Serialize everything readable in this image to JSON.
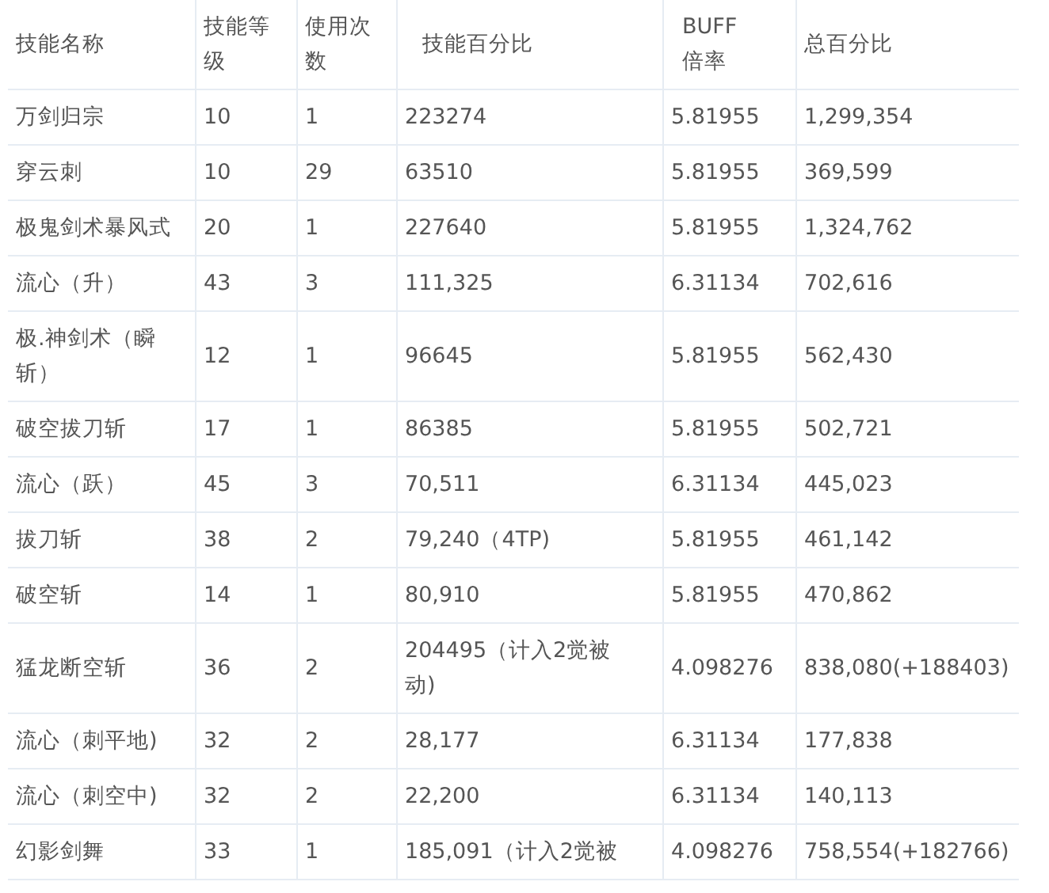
{
  "table": {
    "columns": [
      "技能名称",
      "技能等级",
      "使用次数",
      "技能百分比",
      "BUFF倍率",
      "总百分比"
    ],
    "rows": [
      {
        "cells": [
          "万剑归宗",
          "10",
          "1",
          "223274",
          "5.81955",
          "1,299,354"
        ]
      },
      {
        "cells": [
          "穿云刺",
          "10",
          "29",
          "63510",
          "5.81955",
          "369,599"
        ]
      },
      {
        "cells": [
          "极鬼剑术暴风式",
          "20",
          "1",
          "227640",
          "5.81955",
          "1,324,762"
        ]
      },
      {
        "cells": [
          "流心（升）",
          "43",
          "3",
          "111,325",
          "6.31134",
          "702,616"
        ]
      },
      {
        "cells": [
          "极.神剑术（瞬斩）",
          "12",
          "1",
          "96645",
          "5.81955",
          "562,430"
        ]
      },
      {
        "cells": [
          "破空拔刀斩",
          "17",
          "1",
          "86385",
          "5.81955",
          "502,721"
        ]
      },
      {
        "cells": [
          "流心（跃）",
          "45",
          "3",
          "70,511",
          "6.31134",
          "445,023"
        ]
      },
      {
        "cells": [
          "拔刀斩",
          "38",
          "2",
          "79,240（4TP)",
          "5.81955",
          "461,142"
        ]
      },
      {
        "cells": [
          "破空斩",
          "14",
          "1",
          "80,910",
          "5.81955",
          "470,862"
        ]
      },
      {
        "cells": [
          "猛龙断空斩",
          "36",
          "2",
          "204495（计入2觉被动)",
          "4.098276",
          "838,080(+188403)"
        ]
      },
      {
        "cells": [
          "流心（刺平地)",
          "32",
          "2",
          "28,177",
          "6.31134",
          "177,838"
        ]
      },
      {
        "cells": [
          "流心（刺空中)",
          "32",
          "2",
          "22,200",
          "6.31134",
          "140,113"
        ]
      },
      {
        "cells": [
          "幻影剑舞",
          "33",
          "1",
          "185,091（计入2觉被",
          "4.098276",
          "758,554(+182766)"
        ]
      }
    ]
  }
}
